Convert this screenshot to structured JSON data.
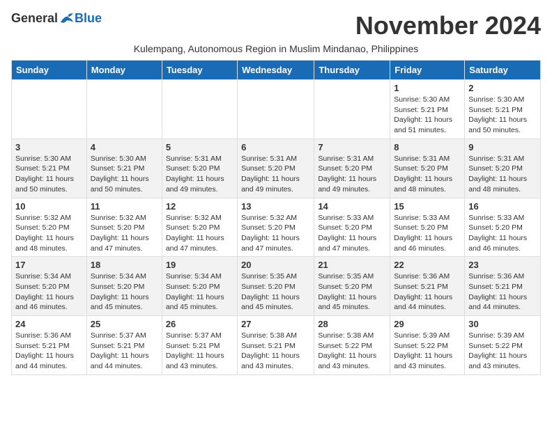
{
  "header": {
    "logo_general": "General",
    "logo_blue": "Blue",
    "month_title": "November 2024",
    "subtitle": "Kulempang, Autonomous Region in Muslim Mindanao, Philippines"
  },
  "columns": [
    "Sunday",
    "Monday",
    "Tuesday",
    "Wednesday",
    "Thursday",
    "Friday",
    "Saturday"
  ],
  "weeks": [
    {
      "days": [
        {
          "num": "",
          "info": ""
        },
        {
          "num": "",
          "info": ""
        },
        {
          "num": "",
          "info": ""
        },
        {
          "num": "",
          "info": ""
        },
        {
          "num": "",
          "info": ""
        },
        {
          "num": "1",
          "info": "Sunrise: 5:30 AM\nSunset: 5:21 PM\nDaylight: 11 hours\nand 51 minutes."
        },
        {
          "num": "2",
          "info": "Sunrise: 5:30 AM\nSunset: 5:21 PM\nDaylight: 11 hours\nand 50 minutes."
        }
      ]
    },
    {
      "days": [
        {
          "num": "3",
          "info": "Sunrise: 5:30 AM\nSunset: 5:21 PM\nDaylight: 11 hours\nand 50 minutes."
        },
        {
          "num": "4",
          "info": "Sunrise: 5:30 AM\nSunset: 5:21 PM\nDaylight: 11 hours\nand 50 minutes."
        },
        {
          "num": "5",
          "info": "Sunrise: 5:31 AM\nSunset: 5:20 PM\nDaylight: 11 hours\nand 49 minutes."
        },
        {
          "num": "6",
          "info": "Sunrise: 5:31 AM\nSunset: 5:20 PM\nDaylight: 11 hours\nand 49 minutes."
        },
        {
          "num": "7",
          "info": "Sunrise: 5:31 AM\nSunset: 5:20 PM\nDaylight: 11 hours\nand 49 minutes."
        },
        {
          "num": "8",
          "info": "Sunrise: 5:31 AM\nSunset: 5:20 PM\nDaylight: 11 hours\nand 48 minutes."
        },
        {
          "num": "9",
          "info": "Sunrise: 5:31 AM\nSunset: 5:20 PM\nDaylight: 11 hours\nand 48 minutes."
        }
      ]
    },
    {
      "days": [
        {
          "num": "10",
          "info": "Sunrise: 5:32 AM\nSunset: 5:20 PM\nDaylight: 11 hours\nand 48 minutes."
        },
        {
          "num": "11",
          "info": "Sunrise: 5:32 AM\nSunset: 5:20 PM\nDaylight: 11 hours\nand 47 minutes."
        },
        {
          "num": "12",
          "info": "Sunrise: 5:32 AM\nSunset: 5:20 PM\nDaylight: 11 hours\nand 47 minutes."
        },
        {
          "num": "13",
          "info": "Sunrise: 5:32 AM\nSunset: 5:20 PM\nDaylight: 11 hours\nand 47 minutes."
        },
        {
          "num": "14",
          "info": "Sunrise: 5:33 AM\nSunset: 5:20 PM\nDaylight: 11 hours\nand 47 minutes."
        },
        {
          "num": "15",
          "info": "Sunrise: 5:33 AM\nSunset: 5:20 PM\nDaylight: 11 hours\nand 46 minutes."
        },
        {
          "num": "16",
          "info": "Sunrise: 5:33 AM\nSunset: 5:20 PM\nDaylight: 11 hours\nand 46 minutes."
        }
      ]
    },
    {
      "days": [
        {
          "num": "17",
          "info": "Sunrise: 5:34 AM\nSunset: 5:20 PM\nDaylight: 11 hours\nand 46 minutes."
        },
        {
          "num": "18",
          "info": "Sunrise: 5:34 AM\nSunset: 5:20 PM\nDaylight: 11 hours\nand 45 minutes."
        },
        {
          "num": "19",
          "info": "Sunrise: 5:34 AM\nSunset: 5:20 PM\nDaylight: 11 hours\nand 45 minutes."
        },
        {
          "num": "20",
          "info": "Sunrise: 5:35 AM\nSunset: 5:20 PM\nDaylight: 11 hours\nand 45 minutes."
        },
        {
          "num": "21",
          "info": "Sunrise: 5:35 AM\nSunset: 5:20 PM\nDaylight: 11 hours\nand 45 minutes."
        },
        {
          "num": "22",
          "info": "Sunrise: 5:36 AM\nSunset: 5:21 PM\nDaylight: 11 hours\nand 44 minutes."
        },
        {
          "num": "23",
          "info": "Sunrise: 5:36 AM\nSunset: 5:21 PM\nDaylight: 11 hours\nand 44 minutes."
        }
      ]
    },
    {
      "days": [
        {
          "num": "24",
          "info": "Sunrise: 5:36 AM\nSunset: 5:21 PM\nDaylight: 11 hours\nand 44 minutes."
        },
        {
          "num": "25",
          "info": "Sunrise: 5:37 AM\nSunset: 5:21 PM\nDaylight: 11 hours\nand 44 minutes."
        },
        {
          "num": "26",
          "info": "Sunrise: 5:37 AM\nSunset: 5:21 PM\nDaylight: 11 hours\nand 43 minutes."
        },
        {
          "num": "27",
          "info": "Sunrise: 5:38 AM\nSunset: 5:21 PM\nDaylight: 11 hours\nand 43 minutes."
        },
        {
          "num": "28",
          "info": "Sunrise: 5:38 AM\nSunset: 5:22 PM\nDaylight: 11 hours\nand 43 minutes."
        },
        {
          "num": "29",
          "info": "Sunrise: 5:39 AM\nSunset: 5:22 PM\nDaylight: 11 hours\nand 43 minutes."
        },
        {
          "num": "30",
          "info": "Sunrise: 5:39 AM\nSunset: 5:22 PM\nDaylight: 11 hours\nand 43 minutes."
        }
      ]
    }
  ]
}
